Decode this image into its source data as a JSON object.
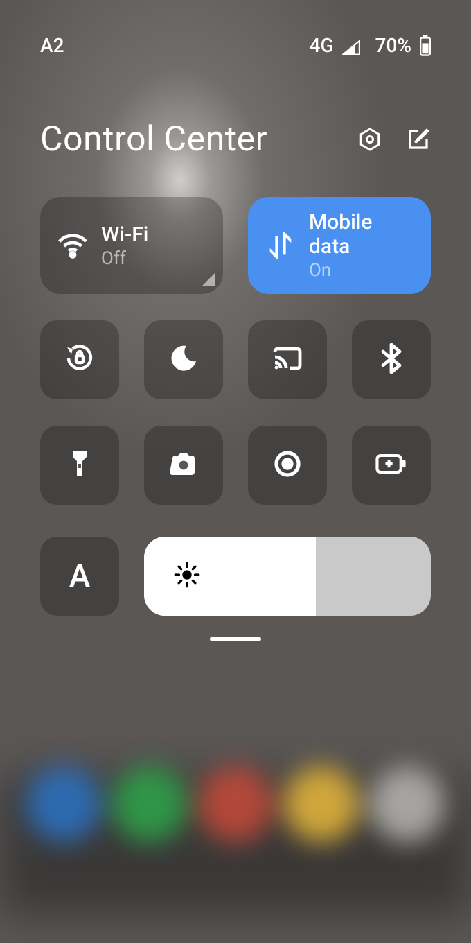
{
  "status": {
    "carrier": "A2",
    "network": "4G",
    "battery": "70%"
  },
  "header": {
    "title": "Control Center"
  },
  "tiles": {
    "wifi": {
      "label": "Wi-Fi",
      "status": "Off"
    },
    "mobile": {
      "label": "Mobile data",
      "status": "On"
    }
  },
  "auto_brightness_label": "A",
  "brightness_percent": 60,
  "colors": {
    "accent": "#4a90f0"
  },
  "dock_colors": [
    "#2b72c4",
    "#2da54a",
    "#c74a3a",
    "#e9b93b",
    "#b8b7b4"
  ]
}
